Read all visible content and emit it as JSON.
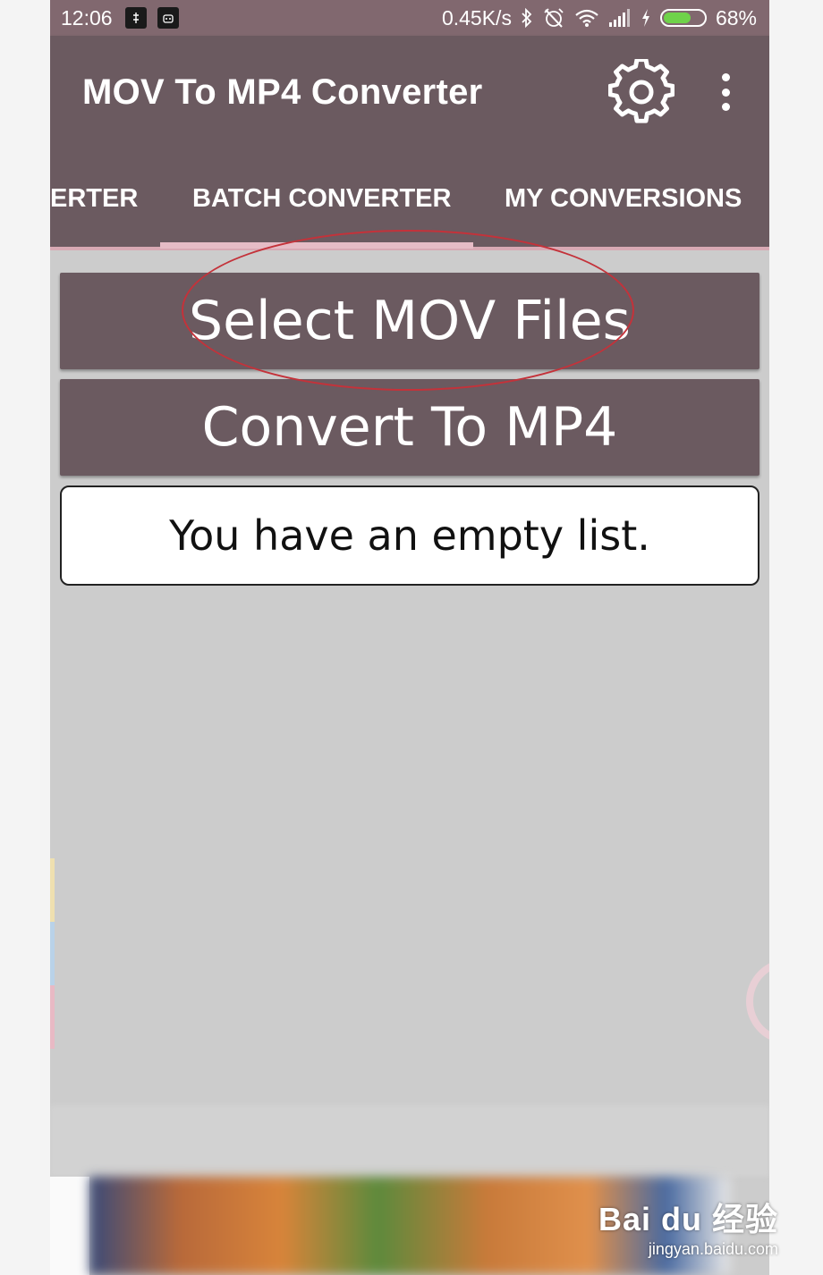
{
  "status_bar": {
    "time": "12:06",
    "speed": "0.45K/s",
    "battery_percent": "68%",
    "battery_level": 0.68,
    "battery_color": "#6fd24a",
    "icons": [
      "bluetooth-icon",
      "alarm-off-icon",
      "wifi-icon",
      "signal-icon",
      "charging-icon",
      "battery-icon"
    ]
  },
  "app_bar": {
    "title": "MOV To MP4 Converter",
    "settings_icon": "gear-icon",
    "menu_icon": "more-vert-icon"
  },
  "tabs": [
    {
      "label": "ERTER"
    },
    {
      "label": "BATCH CONVERTER",
      "selected": true
    },
    {
      "label": "MY CONVERSIONS"
    }
  ],
  "main": {
    "select_button": "Select MOV Files",
    "convert_button": "Convert To MP4",
    "empty_message": "You have an empty list."
  },
  "watermark": {
    "logo": "Bai du 经验",
    "url": "jingyan.baidu.com"
  },
  "colors": {
    "status_bar": "#81686f",
    "app_bar": "#6b5a60",
    "tab_indicator": "#e6bcc6",
    "content_bg": "#cccccc",
    "highlight": "#c4323a"
  }
}
